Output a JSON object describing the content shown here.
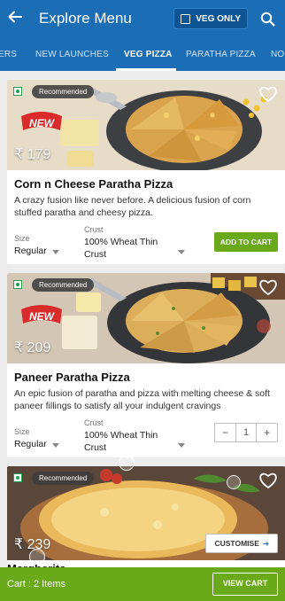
{
  "header": {
    "title": "Explore Menu",
    "veg_only_label": "VEG ONLY"
  },
  "tabs": [
    {
      "label": "ERS"
    },
    {
      "label": "NEW LAUNCHES"
    },
    {
      "label": "VEG PIZZA"
    },
    {
      "label": "PARATHA PIZZA"
    },
    {
      "label": "NO"
    }
  ],
  "active_tab": "VEG PIZZA",
  "icons": {
    "back": "arrow-back-icon",
    "search": "search-icon",
    "heart": "heart-icon",
    "veg": "veg-mark-icon"
  },
  "colors": {
    "header_blue": "#1b6eb5",
    "add_green": "#69a91a",
    "veg_green": "#1ba34b"
  },
  "products": [
    {
      "badge": "Recommended",
      "new_badge": "NEW",
      "price": "₹ 179",
      "name": "Corn n Cheese Paratha Pizza",
      "description": "A crazy fusion like never before. A delicious fusion of corn stuffed paratha and cheesy pizza.",
      "size_label": "Size",
      "size_value": "Regular",
      "crust_label": "Crust",
      "crust_value": "100% Wheat Thin Crust",
      "action_label": "ADD TO CART"
    },
    {
      "badge": "Recommended",
      "new_badge": "NEW",
      "price": "₹ 209",
      "name": "Paneer Paratha Pizza",
      "description": "An epic fusion of paratha and pizza with melting cheese & soft paneer fillings to satisfy all your indulgent cravings",
      "size_label": "Size",
      "size_value": "Regular",
      "crust_label": "Crust",
      "crust_value": "100% Wheat Thin Crust",
      "stepper": {
        "minus": "−",
        "count": "1",
        "plus": "+"
      }
    },
    {
      "badge": "Recommended",
      "price": "₹ 239",
      "name": "Margherita",
      "customise_label": "CUSTOMISE"
    }
  ],
  "cart": {
    "summary": "Cart : 2 Items",
    "button_label": "VIEW CART"
  }
}
